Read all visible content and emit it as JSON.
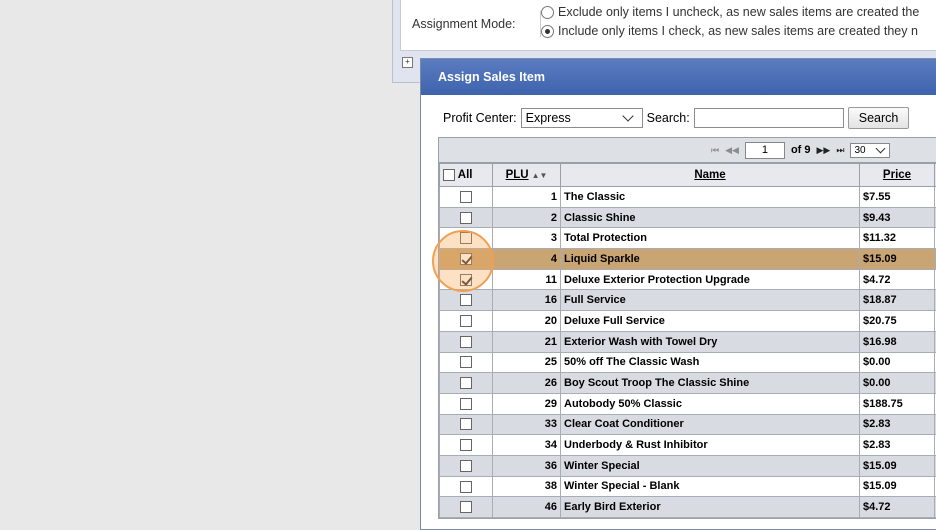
{
  "background": {
    "assignment_mode_label": "Assignment Mode:",
    "option_exclude": "Exclude only items I uncheck, as new sales items are created the",
    "option_include": "Include only items I check, as new sales items are created they n"
  },
  "dialog": {
    "title": "Assign Sales Item",
    "profit_center_label": "Profit Center:",
    "profit_center_value": "Express",
    "search_label": "Search:",
    "search_value": "",
    "search_button": "Search"
  },
  "pager": {
    "current_page": "1",
    "of_text": "of 9",
    "page_size": "30"
  },
  "columns": {
    "all": "All",
    "plu": "PLU",
    "name": "Name",
    "price": "Price"
  },
  "rows": [
    {
      "checked": false,
      "plu": "1",
      "name": "The Classic",
      "price": "$7.55"
    },
    {
      "checked": false,
      "plu": "2",
      "name": "Classic Shine",
      "price": "$9.43"
    },
    {
      "checked": false,
      "plu": "3",
      "name": "Total Protection",
      "price": "$11.32"
    },
    {
      "checked": true,
      "plu": "4",
      "name": "Liquid Sparkle",
      "price": "$15.09"
    },
    {
      "checked": true,
      "plu": "11",
      "name": "Deluxe Exterior Protection Upgrade",
      "price": "$4.72"
    },
    {
      "checked": false,
      "plu": "16",
      "name": "Full Service",
      "price": "$18.87"
    },
    {
      "checked": false,
      "plu": "20",
      "name": "Deluxe Full Service",
      "price": "$20.75"
    },
    {
      "checked": false,
      "plu": "21",
      "name": "Exterior Wash with Towel Dry",
      "price": "$16.98"
    },
    {
      "checked": false,
      "plu": "25",
      "name": "50% off The Classic Wash",
      "price": "$0.00"
    },
    {
      "checked": false,
      "plu": "26",
      "name": "Boy Scout Troop The Classic Shine",
      "price": "$0.00"
    },
    {
      "checked": false,
      "plu": "29",
      "name": "Autobody 50% Classic",
      "price": "$188.75"
    },
    {
      "checked": false,
      "plu": "33",
      "name": "Clear Coat Conditioner",
      "price": "$2.83"
    },
    {
      "checked": false,
      "plu": "34",
      "name": "Underbody & Rust Inhibitor",
      "price": "$2.83"
    },
    {
      "checked": false,
      "plu": "36",
      "name": "Winter Special",
      "price": "$15.09"
    },
    {
      "checked": false,
      "plu": "38",
      "name": "Winter Special - Blank",
      "price": "$15.09"
    },
    {
      "checked": false,
      "plu": "46",
      "name": "Early Bird Exterior",
      "price": "$4.72"
    }
  ],
  "colors": {
    "title_bar": "#4a6fb8",
    "selected_row": "#c9a574",
    "even_row": "#d9dbe2",
    "highlight_ring": "#f0a050"
  },
  "icons": {
    "first_page": "first-page-icon",
    "prev_page": "prev-page-icon",
    "next_page": "next-page-icon",
    "last_page": "last-page-icon",
    "sort": "sort-icon"
  }
}
